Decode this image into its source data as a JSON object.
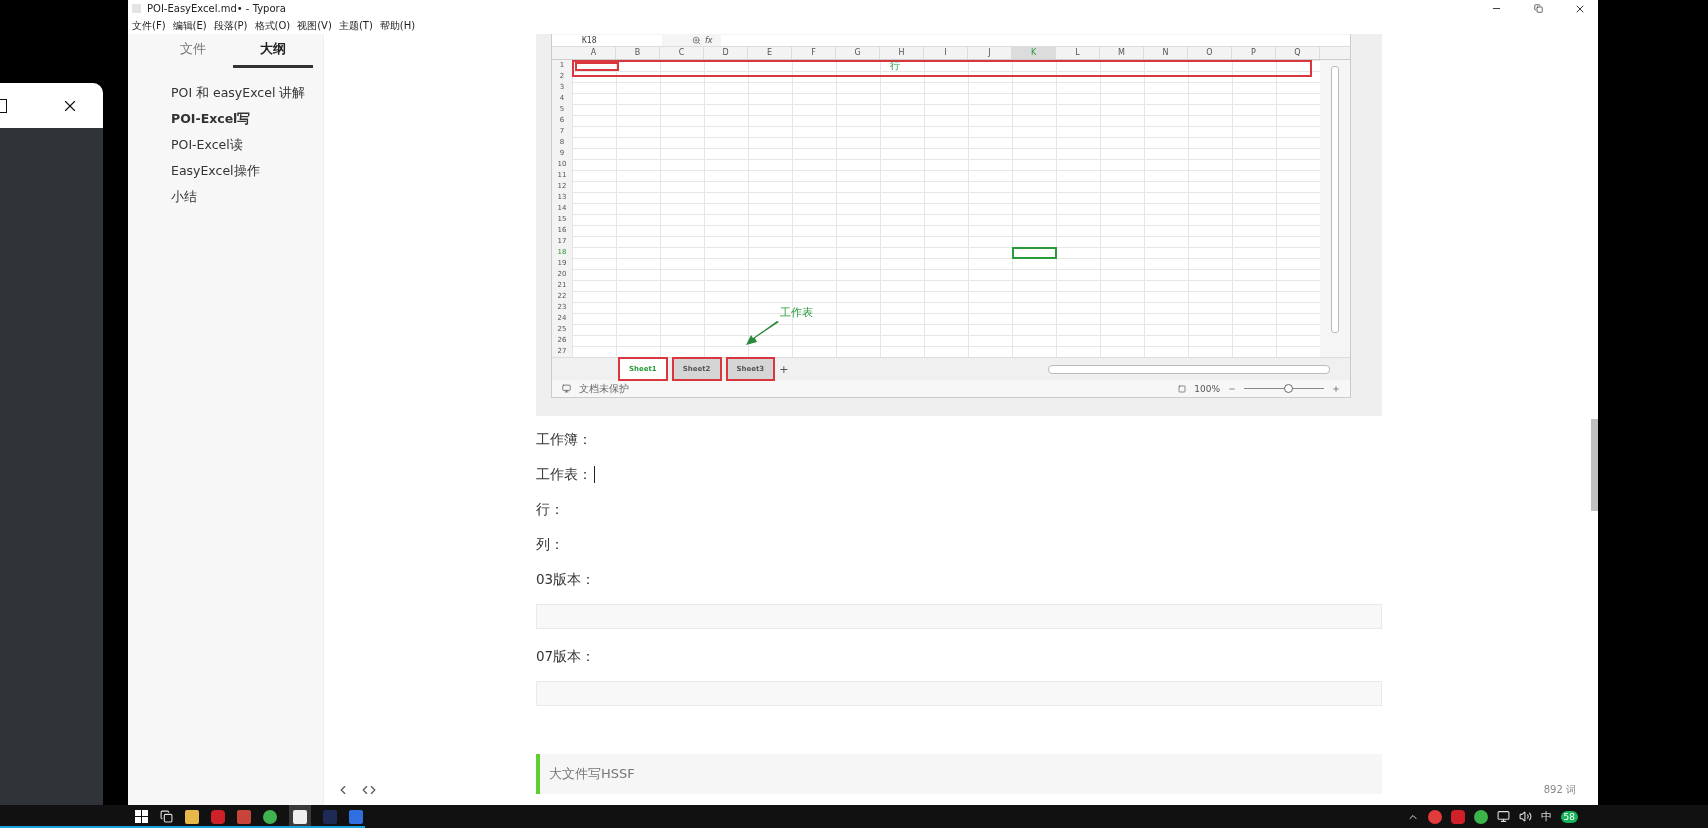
{
  "window": {
    "title": "POI-EasyExcel.md• - Typora"
  },
  "menu": [
    "文件(F)",
    "编辑(E)",
    "段落(P)",
    "格式(O)",
    "视图(V)",
    "主题(T)",
    "帮助(H)"
  ],
  "sidebar": {
    "tabs": [
      {
        "label": "文件",
        "selected": false
      },
      {
        "label": "大纲",
        "selected": true
      }
    ],
    "outline": [
      {
        "label": "POI 和 easyExcel 讲解",
        "selected": false
      },
      {
        "label": "POI-Excel写",
        "selected": true
      },
      {
        "label": "POI-Excel读",
        "selected": false
      },
      {
        "label": "EasyExcel操作",
        "selected": false
      },
      {
        "label": "小结",
        "selected": false
      }
    ]
  },
  "spreadsheet": {
    "name_box": "K18",
    "formula_label": "fx",
    "columns": [
      {
        "label": "A",
        "selected": false
      },
      {
        "label": "B",
        "selected": false
      },
      {
        "label": "C",
        "selected": false
      },
      {
        "label": "D",
        "selected": false
      },
      {
        "label": "E",
        "selected": false
      },
      {
        "label": "F",
        "selected": false
      },
      {
        "label": "G",
        "selected": false
      },
      {
        "label": "H",
        "selected": false
      },
      {
        "label": "I",
        "selected": false
      },
      {
        "label": "J",
        "selected": false
      },
      {
        "label": "K",
        "selected": true
      },
      {
        "label": "L",
        "selected": false
      },
      {
        "label": "M",
        "selected": false
      },
      {
        "label": "N",
        "selected": false
      },
      {
        "label": "O",
        "selected": false
      },
      {
        "label": "P",
        "selected": false
      },
      {
        "label": "Q",
        "selected": false
      }
    ],
    "rows": [
      {
        "label": "1",
        "selected": false
      },
      {
        "label": "2",
        "selected": false
      },
      {
        "label": "3",
        "selected": false
      },
      {
        "label": "4",
        "selected": false
      },
      {
        "label": "5",
        "selected": false
      },
      {
        "label": "6",
        "selected": false
      },
      {
        "label": "7",
        "selected": false
      },
      {
        "label": "8",
        "selected": false
      },
      {
        "label": "9",
        "selected": false
      },
      {
        "label": "10",
        "selected": false
      },
      {
        "label": "11",
        "selected": false
      },
      {
        "label": "12",
        "selected": false
      },
      {
        "label": "13",
        "selected": false
      },
      {
        "label": "14",
        "selected": false
      },
      {
        "label": "15",
        "selected": false
      },
      {
        "label": "16",
        "selected": false
      },
      {
        "label": "17",
        "selected": false
      },
      {
        "label": "18",
        "selected": true
      },
      {
        "label": "19",
        "selected": false
      },
      {
        "label": "20",
        "selected": false
      },
      {
        "label": "21",
        "selected": false
      },
      {
        "label": "22",
        "selected": false
      },
      {
        "label": "23",
        "selected": false
      },
      {
        "label": "24",
        "selected": false
      },
      {
        "label": "25",
        "selected": false
      },
      {
        "label": "26",
        "selected": false
      },
      {
        "label": "27",
        "selected": false
      }
    ],
    "row_note": "行",
    "sheet_note": "工作表",
    "sheets": [
      {
        "label": "Sheet1",
        "selected": true
      },
      {
        "label": "Sheet2",
        "selected": false
      },
      {
        "label": "Sheet3",
        "selected": false
      }
    ],
    "add_sheet": "+",
    "protection": "文档未保护",
    "zoom": "100%",
    "zoom_slider": {
      "level": 0.55
    }
  },
  "content": [
    {
      "kind": "paragraph",
      "text": "工作簿：",
      "cursor": false
    },
    {
      "kind": "paragraph",
      "text": "工作表：",
      "cursor": true
    },
    {
      "kind": "paragraph",
      "text": "行：",
      "cursor": false
    },
    {
      "kind": "paragraph",
      "text": "列：",
      "cursor": false
    },
    {
      "kind": "paragraph",
      "text": "03版本：",
      "cursor": false
    },
    {
      "kind": "code"
    },
    {
      "kind": "paragraph",
      "text": "07版本：",
      "cursor": false
    },
    {
      "kind": "code"
    },
    {
      "kind": "quote",
      "text": "大文件写HSSF"
    }
  ],
  "status": {
    "word_count": "892 词"
  },
  "tray": {
    "ime": "中",
    "badge": "58"
  }
}
